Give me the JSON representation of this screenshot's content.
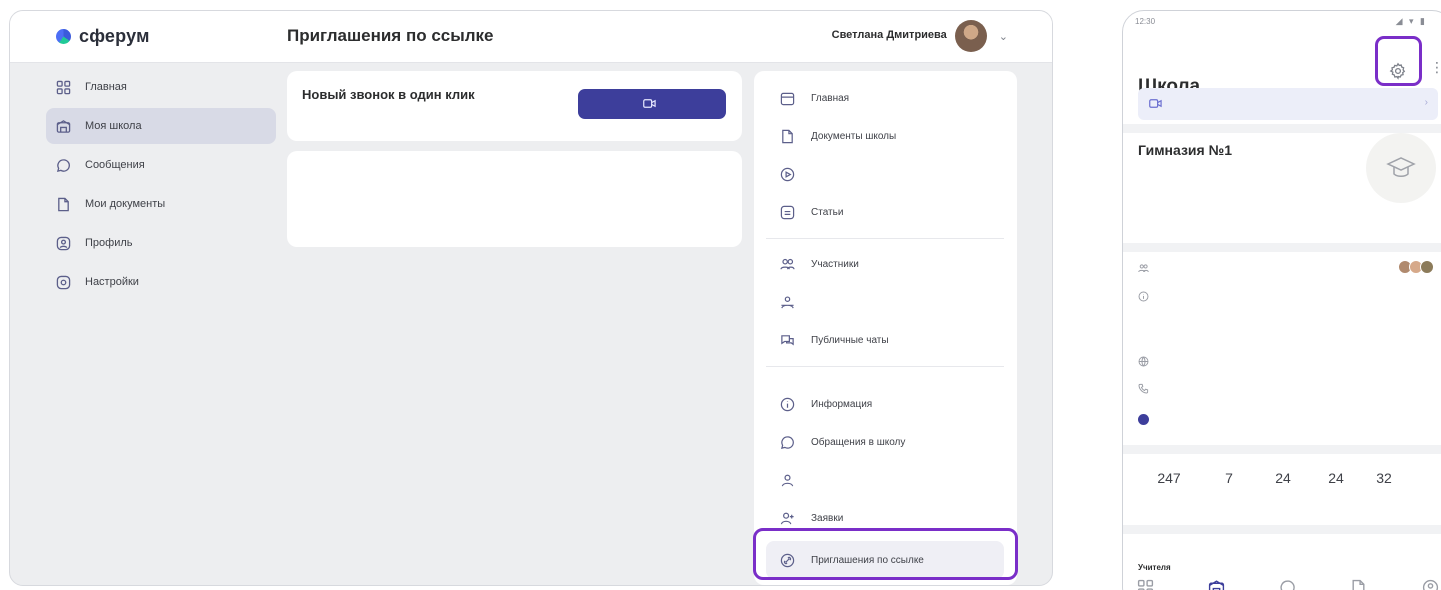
{
  "desktop": {
    "logo_text": "сферум",
    "page_title": "Приглашения по ссылке",
    "user": {
      "name": "Светлана Дмитриева",
      "role": ""
    },
    "left_nav": [
      {
        "label": "Главная",
        "icon": "grid-icon"
      },
      {
        "label": "Моя школа",
        "icon": "school-icon",
        "active": true
      },
      {
        "label": "Сообщения",
        "icon": "chat-icon"
      },
      {
        "label": "Мои документы",
        "icon": "document-icon"
      },
      {
        "label": "Профиль",
        "icon": "profile-icon"
      },
      {
        "label": "Настройки",
        "icon": "gear-icon"
      }
    ],
    "footer": {
      "privacy": "",
      "terms": "",
      "help": ""
    },
    "quick_call": {
      "title": "Новый звонок в один клик",
      "subtitle": "",
      "button_label": ""
    },
    "invite_card": {
      "text": "",
      "create_link": ""
    },
    "right_nav": [
      {
        "label": "Главная",
        "icon": "calendar-icon"
      },
      {
        "label": "Документы школы",
        "icon": "document-icon"
      },
      {
        "label": "",
        "icon": "video-icon"
      },
      {
        "label": "Статьи",
        "icon": "article-icon"
      },
      {
        "label": "Участники",
        "icon": "people-icon"
      },
      {
        "label": "",
        "icon": "classes-icon"
      },
      {
        "label": "Публичные чаты",
        "icon": "chats-icon"
      },
      {
        "label": "Информация",
        "icon": "info-icon"
      },
      {
        "label": "Обращения в школу",
        "icon": "chat-icon"
      },
      {
        "label": "",
        "icon": "person-icon"
      },
      {
        "label": "Заявки",
        "icon": "add-person-icon"
      },
      {
        "label": "Приглашения по ссылке",
        "icon": "link-icon",
        "selected": true
      }
    ]
  },
  "phone": {
    "time": "12:30",
    "title": "Школа",
    "call_label": "",
    "school": {
      "name": "Гимназия №1",
      "type": "",
      "note": "",
      "members": "",
      "description": "",
      "website": "",
      "phone": "",
      "more": ""
    },
    "stats": [
      {
        "num": "247",
        "label": ""
      },
      {
        "num": "7",
        "label": ""
      },
      {
        "num": "24",
        "label": ""
      },
      {
        "num": "24",
        "label": ""
      },
      {
        "num": "32",
        "label": ""
      }
    ],
    "teachers_label": "Учителя",
    "teachers_count": "",
    "show_all": ""
  },
  "colors": {
    "accent": "#3d3e9b",
    "highlight": "#7a2ec8",
    "panel_bg": "#edeef0"
  }
}
